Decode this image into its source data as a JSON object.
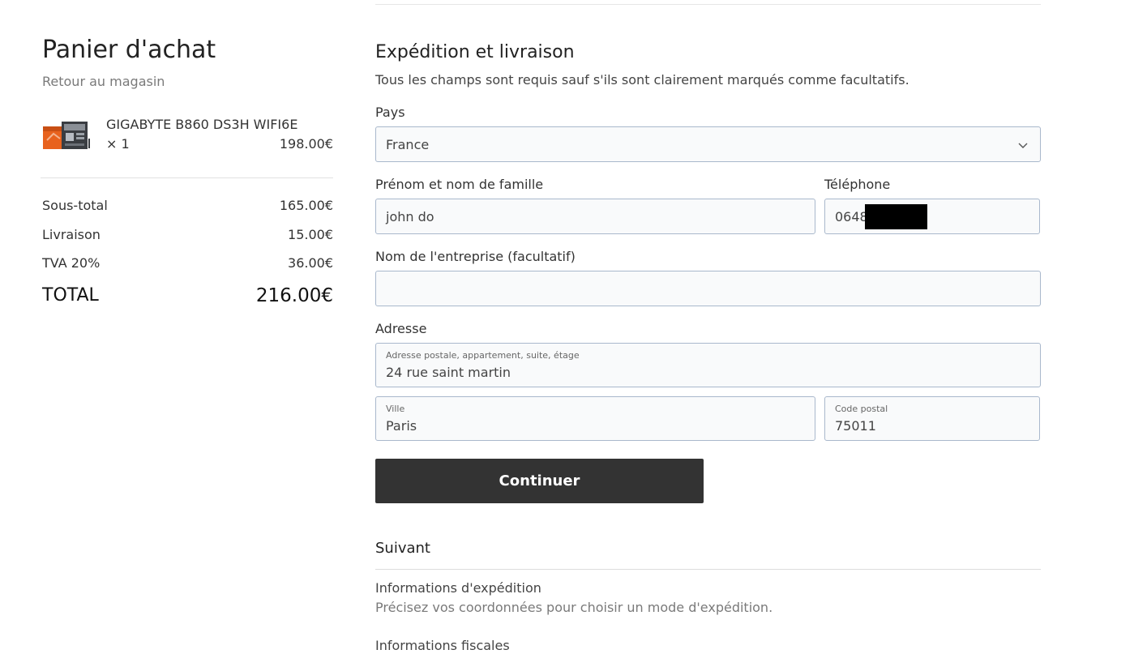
{
  "cart": {
    "title": "Panier d'achat",
    "back_link": "Retour au magasin",
    "item": {
      "thumb_icon": "motherboard-product-image",
      "name": "GIGABYTE B860 DS3H WIFI6E",
      "qty": "× 1",
      "price": "198.00€"
    },
    "summary": [
      {
        "label": "Sous-total",
        "value": "165.00€"
      },
      {
        "label": "Livraison",
        "value": "15.00€"
      },
      {
        "label": "TVA 20%",
        "value": "36.00€"
      }
    ],
    "total": {
      "label": "TOTAL",
      "value": "216.00€"
    }
  },
  "form": {
    "title": "Expédition et livraison",
    "note": "Tous les champs sont requis sauf s'ils sont clairement marqués comme facultatifs.",
    "country": {
      "label": "Pays",
      "value": "France",
      "icon": "chevron-down-icon"
    },
    "name": {
      "label": "Prénom et nom de famille",
      "value": "john do"
    },
    "phone": {
      "label": "Téléphone",
      "value": "0648"
    },
    "company": {
      "label": "Nom de l'entreprise (facultatif)",
      "value": ""
    },
    "address": {
      "label": "Adresse",
      "street_label": "Adresse postale, appartement, suite, étage",
      "street_value": "24 rue saint martin",
      "city_label": "Ville",
      "city_value": "Paris",
      "zip_label": "Code postal",
      "zip_value": "75011"
    },
    "continue_label": "Continuer"
  },
  "next": {
    "title": "Suivant",
    "steps": [
      {
        "title": "Informations d'expédition",
        "desc": "Précisez vos coordonnées pour choisir un mode d'expédition."
      },
      {
        "title": "Informations fiscales",
        "desc": ""
      }
    ]
  },
  "colors": {
    "button_bg": "#333333",
    "field_border": "#a9b8cc",
    "field_bg": "#f9fafb"
  }
}
